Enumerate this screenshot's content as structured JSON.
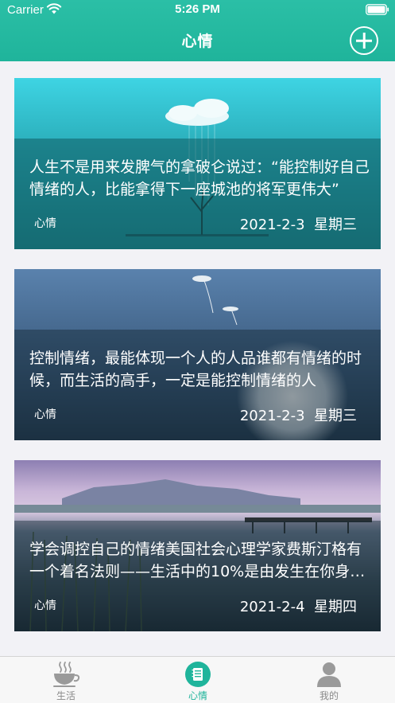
{
  "status_bar": {
    "carrier": "Carrier",
    "time": "5:26 PM"
  },
  "header": {
    "title": "心情",
    "add_icon": "plus-circle-icon"
  },
  "posts": [
    {
      "text": "人生不是用来发脾气的拿破仑说过：“能控制好自己情绪的人，比能拿得下一座城池的将军更伟大”",
      "tag": "心情",
      "date": "2021-2-3",
      "weekday": "星期三",
      "image": "cloud-raining-on-tree"
    },
    {
      "text": "控制情绪，最能体现一个人的人品谁都有情绪的时候，而生活的高手，一定是能控制情绪的人",
      "tag": "心情",
      "date": "2021-2-3",
      "weekday": "星期三",
      "image": "dandelion-seeds"
    },
    {
      "text": "学会调控自己的情绪美国社会心理学家费斯汀格有一个着名法则——生活中的10%是由发生在你身上的事情组成",
      "tag": "心情",
      "date": "2021-2-4",
      "weekday": "星期四",
      "image": "lake-with-mountains-and-pier"
    }
  ],
  "tab_bar": {
    "items": [
      {
        "label": "生活",
        "icon": "coffee-cup-icon",
        "active": false
      },
      {
        "label": "心情",
        "icon": "notebook-icon",
        "active": true
      },
      {
        "label": "我的",
        "icon": "person-icon",
        "active": false
      }
    ]
  },
  "colors": {
    "brand": "#1fb49b",
    "background": "#f2f2f6",
    "tab_inactive": "#8a8a8a"
  }
}
